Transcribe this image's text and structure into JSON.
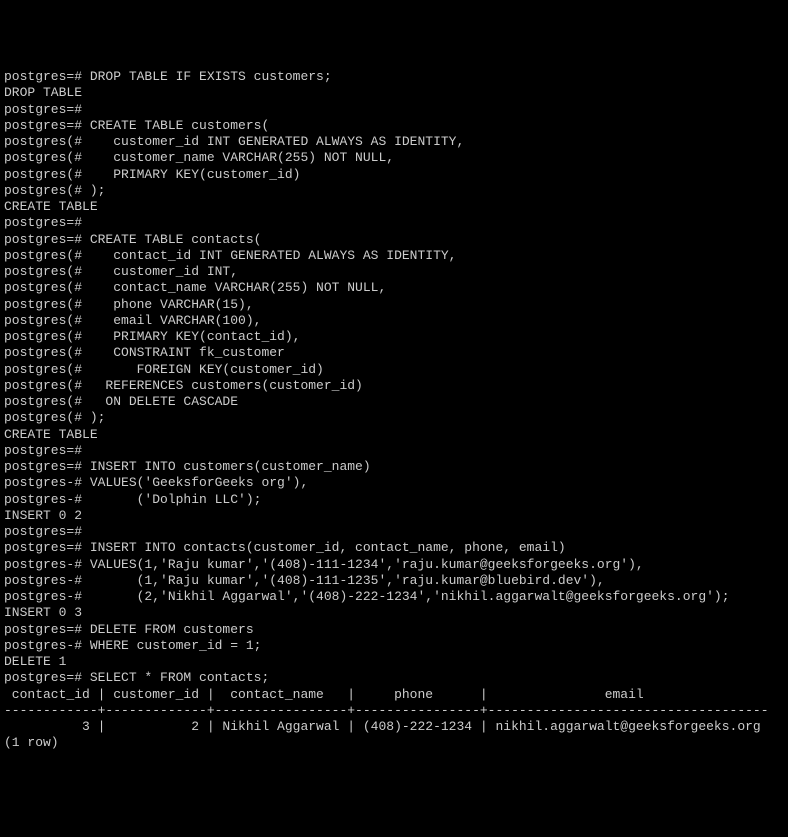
{
  "prompt_main": "postgres=#",
  "prompt_cont_paren": "postgres(#",
  "prompt_cont_dash": "postgres-#",
  "lines": [
    "postgres=# DROP TABLE IF EXISTS customers;",
    "DROP TABLE",
    "postgres=#",
    "postgres=# CREATE TABLE customers(",
    "postgres(#    customer_id INT GENERATED ALWAYS AS IDENTITY,",
    "postgres(#    customer_name VARCHAR(255) NOT NULL,",
    "postgres(#    PRIMARY KEY(customer_id)",
    "postgres(# );",
    "CREATE TABLE",
    "postgres=#",
    "postgres=# CREATE TABLE contacts(",
    "postgres(#    contact_id INT GENERATED ALWAYS AS IDENTITY,",
    "postgres(#    customer_id INT,",
    "postgres(#    contact_name VARCHAR(255) NOT NULL,",
    "postgres(#    phone VARCHAR(15),",
    "postgres(#    email VARCHAR(100),",
    "postgres(#    PRIMARY KEY(contact_id),",
    "postgres(#    CONSTRAINT fk_customer",
    "postgres(#       FOREIGN KEY(customer_id)",
    "postgres(#   REFERENCES customers(customer_id)",
    "postgres(#   ON DELETE CASCADE",
    "postgres(# );",
    "CREATE TABLE",
    "postgres=#",
    "postgres=# INSERT INTO customers(customer_name)",
    "postgres-# VALUES('GeeksforGeeks org'),",
    "postgres-#       ('Dolphin LLC');",
    "INSERT 0 2",
    "postgres=#",
    "postgres=# INSERT INTO contacts(customer_id, contact_name, phone, email)",
    "postgres-# VALUES(1,'Raju kumar','(408)-111-1234','raju.kumar@geeksforgeeks.org'),",
    "postgres-#       (1,'Raju kumar','(408)-111-1235','raju.kumar@bluebird.dev'),",
    "postgres-#       (2,'Nikhil Aggarwal','(408)-222-1234','nikhil.aggarwalt@geeksforgeeks.org');",
    "INSERT 0 3",
    "postgres=# DELETE FROM customers",
    "postgres-# WHERE customer_id = 1;",
    "DELETE 1",
    "postgres=# SELECT * FROM contacts;",
    " contact_id | customer_id |  contact_name   |     phone      |               email",
    "------------+-------------+-----------------+----------------+------------------------------------",
    "          3 |           2 | Nikhil Aggarwal | (408)-222-1234 | nikhil.aggarwalt@geeksforgeeks.org",
    "(1 row)",
    ""
  ],
  "chart_data": {
    "type": "table",
    "title": "SELECT * FROM contacts",
    "columns": [
      "contact_id",
      "customer_id",
      "contact_name",
      "phone",
      "email"
    ],
    "rows": [
      {
        "contact_id": 3,
        "customer_id": 2,
        "contact_name": "Nikhil Aggarwal",
        "phone": "(408)-222-1234",
        "email": "nikhil.aggarwalt@geeksforgeeks.org"
      }
    ],
    "row_count_text": "(1 row)"
  }
}
